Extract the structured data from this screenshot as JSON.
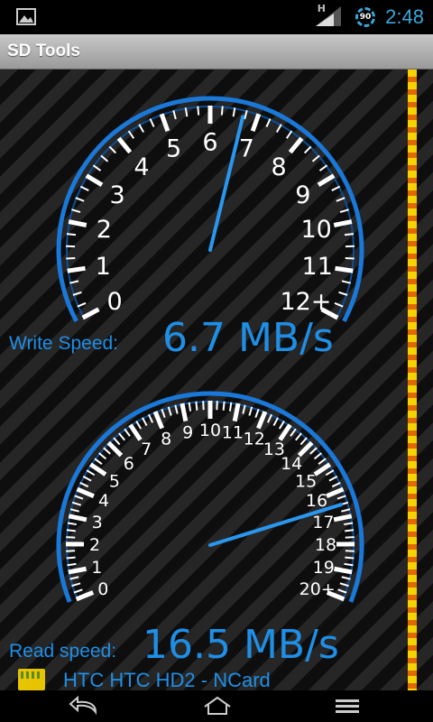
{
  "status_bar": {
    "network_label": "H",
    "battery_level": "90",
    "time": "2:48",
    "notification_icon": "image-icon"
  },
  "app": {
    "title": "SD Tools"
  },
  "write_gauge": {
    "ticks": [
      "0",
      "1",
      "2",
      "3",
      "4",
      "5",
      "6",
      "7",
      "8",
      "9",
      "10",
      "11",
      "12+"
    ],
    "max": 12,
    "value": 6.7,
    "label": "Write Speed:",
    "display": "6.7 MB/s"
  },
  "read_gauge": {
    "ticks": [
      "0",
      "1",
      "2",
      "3",
      "4",
      "5",
      "6",
      "7",
      "8",
      "9",
      "10",
      "11",
      "12",
      "13",
      "14",
      "15",
      "16",
      "17",
      "18",
      "19",
      "20+"
    ],
    "max": 20,
    "value": 16.5,
    "label": "Read speed:",
    "display": "16.5 MB/s"
  },
  "card": {
    "name": "HTC HTC HD2 - NCard"
  },
  "colors": {
    "accent": "#1f8fe6",
    "gauge_ring": "#1a78d8",
    "stripe_yellow": "#f6d300",
    "stripe_orange": "#e06a00"
  },
  "nav": {
    "back": "back-icon",
    "home": "home-icon",
    "menu": "menu-icon"
  }
}
